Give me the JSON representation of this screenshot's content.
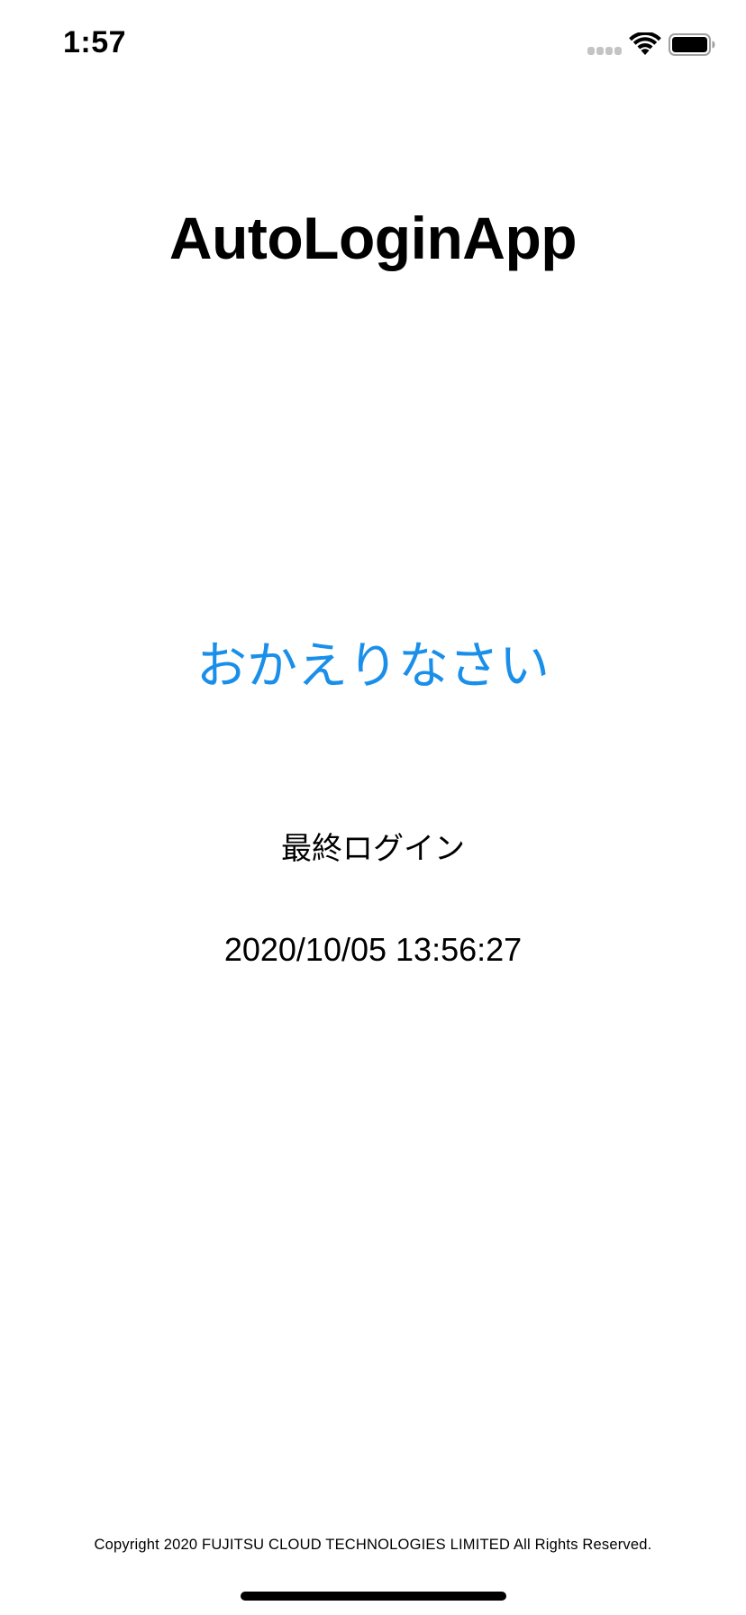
{
  "status_bar": {
    "time": "1:57",
    "icons": [
      "cellular-signal-icon",
      "wifi-icon",
      "battery-icon"
    ]
  },
  "app": {
    "title": "AutoLoginApp"
  },
  "welcome": {
    "message": "おかえりなさい",
    "color": "#1a8fea"
  },
  "last_login": {
    "label": "最終ログイン",
    "value": "2020/10/05 13:56:27"
  },
  "footer": {
    "copyright": "Copyright 2020 FUJITSU CLOUD TECHNOLOGIES LIMITED All Rights Reserved."
  }
}
